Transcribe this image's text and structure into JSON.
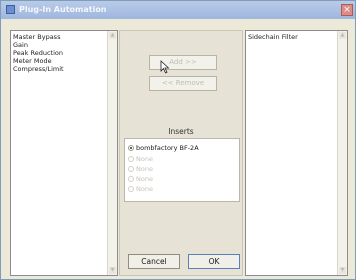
{
  "window": {
    "title": "Plug-In Automation",
    "close_glyph": "×"
  },
  "available_params": [
    "Master Bypass",
    "Gain",
    "Peak Reduction",
    "Meter Mode",
    "Compress/Limit"
  ],
  "automated_params": [
    "Sidechain Filter"
  ],
  "buttons": {
    "add": "Add >>",
    "remove": "<< Remove",
    "cancel": "Cancel",
    "ok": "OK"
  },
  "inserts": {
    "label": "Inserts",
    "options": [
      {
        "label": "bombfactory BF-2A",
        "selected": true
      },
      {
        "label": "None",
        "selected": false
      },
      {
        "label": "None",
        "selected": false
      },
      {
        "label": "None",
        "selected": false
      },
      {
        "label": "None",
        "selected": false
      }
    ]
  },
  "scroll_up_glyph": "▲",
  "scroll_down_glyph": "▼",
  "icons": {
    "title": "plug-in-icon",
    "cursor": "mouse-pointer-icon"
  }
}
